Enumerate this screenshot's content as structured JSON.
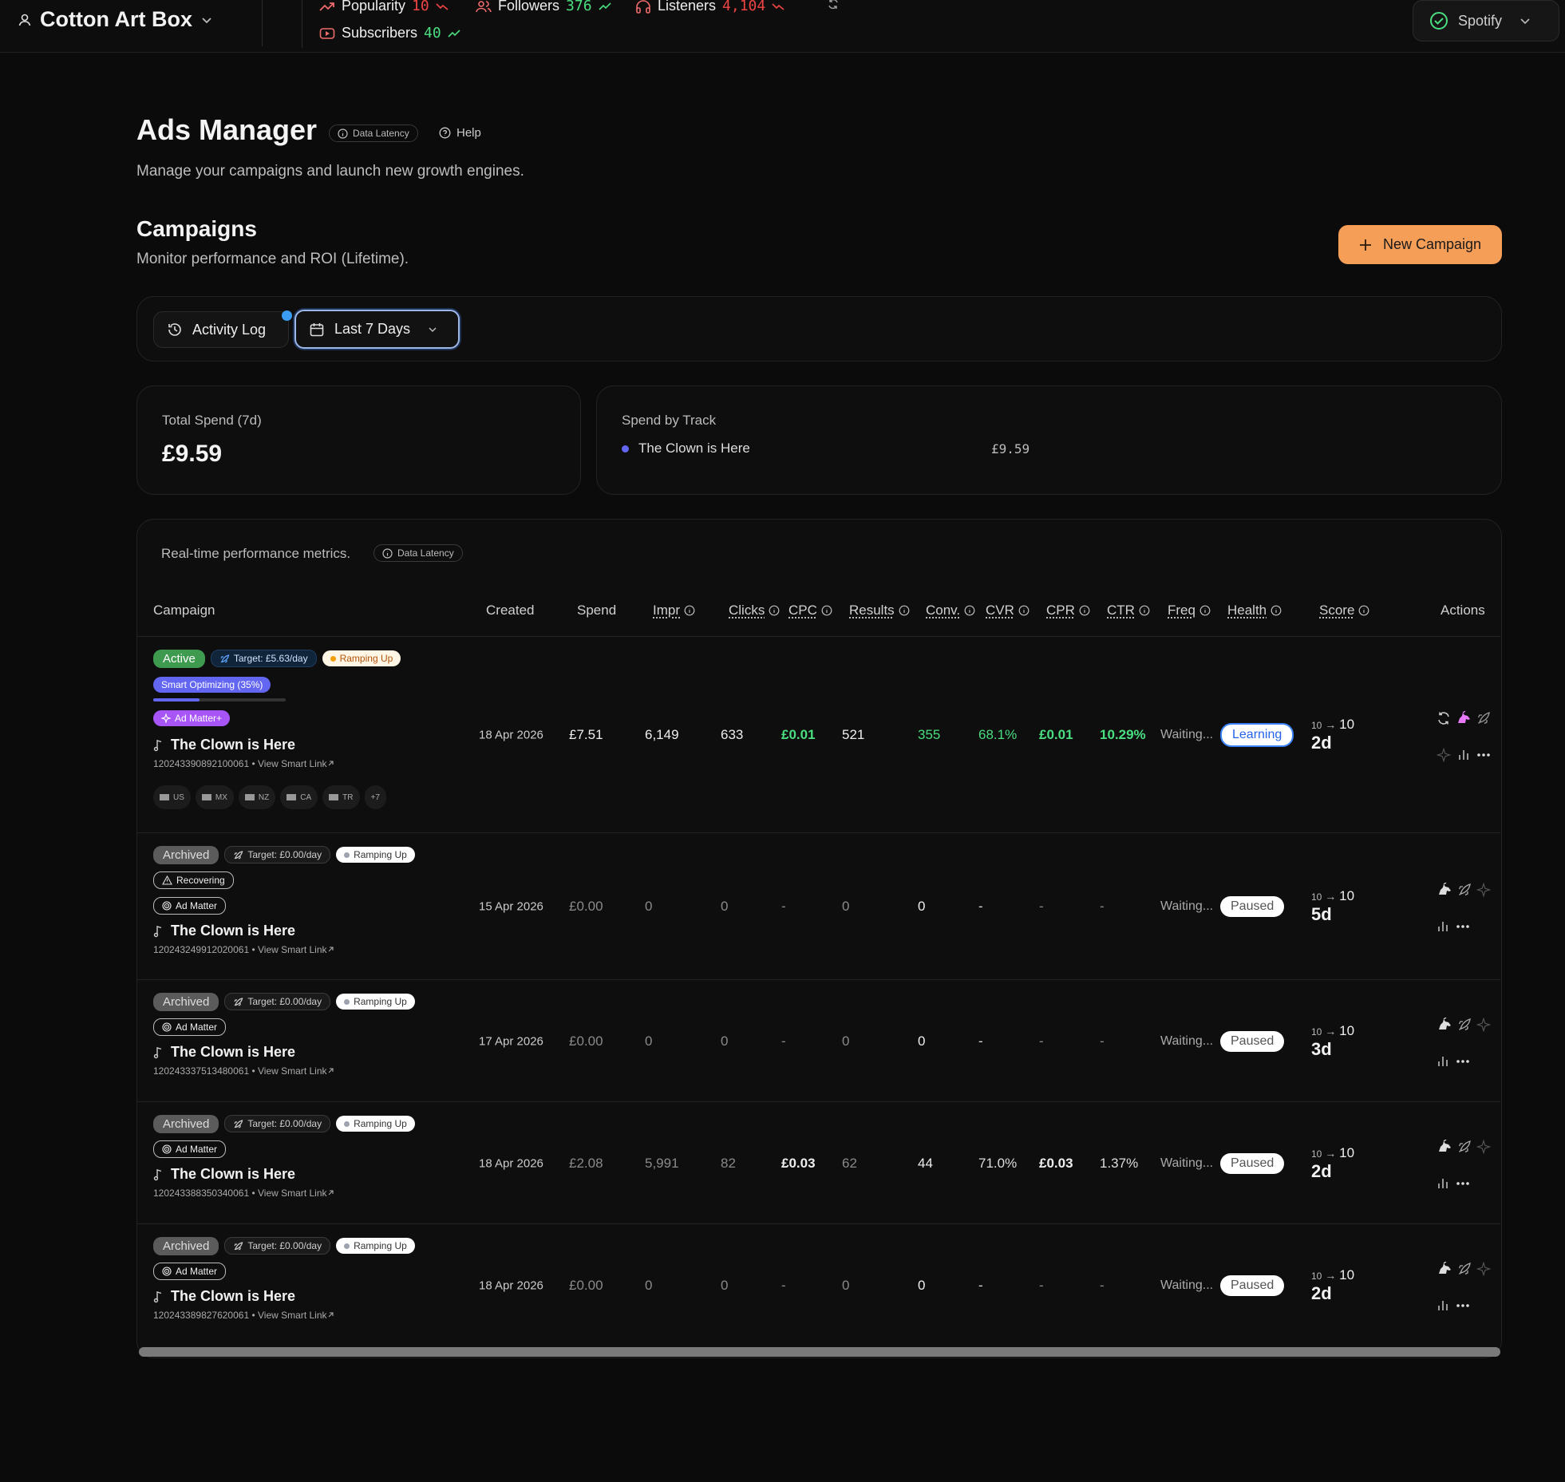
{
  "topbar": {
    "account_name": "Cotton Art Box",
    "stats": [
      {
        "label": "Popularity",
        "value": "10",
        "trend": "down"
      },
      {
        "label": "Followers",
        "value": "376",
        "trend": "up"
      },
      {
        "label": "Listeners",
        "value": "4,104",
        "trend": "down"
      },
      {
        "label": "Subscribers",
        "value": "40",
        "trend": "up"
      }
    ],
    "platform": "Spotify"
  },
  "header": {
    "title": "Ads Manager",
    "data_latency": "Data Latency",
    "help": "Help",
    "subtitle": "Manage your campaigns and launch new growth engines."
  },
  "campaigns_section": {
    "title": "Campaigns",
    "subtitle": "Monitor performance and ROI (Lifetime).",
    "new_button": "New Campaign"
  },
  "controls": {
    "activity_log": "Activity Log",
    "date_range": "Last 7 Days"
  },
  "summary": {
    "total_spend_label": "Total Spend (7d)",
    "total_spend_value": "£9.59",
    "spend_by_track_label": "Spend by Track",
    "tracks": [
      {
        "name": "The Clown is Here",
        "value": "£9.59"
      }
    ]
  },
  "table": {
    "caption": "Real-time performance metrics.",
    "data_latency": "Data Latency",
    "columns": [
      "Campaign",
      "Created",
      "Spend",
      "Impr",
      "Clicks",
      "CPC",
      "Results",
      "Conv.",
      "CVR",
      "CPR",
      "CTR",
      "Freq",
      "Health",
      "Score",
      "Actions"
    ],
    "rows": [
      {
        "status": "Active",
        "target": "Target: £5.63/day",
        "ramp": "Ramping Up",
        "smart": "Smart Optimizing (35%)",
        "smart_progress": 0.35,
        "admatter": "Ad Matter+",
        "track": "The Clown is Here",
        "id": "120243390892100061",
        "link": "View Smart Link",
        "countries": [
          "US",
          "MX",
          "NZ",
          "CA",
          "TR"
        ],
        "more": "+7",
        "created": "18 Apr 2026",
        "spend": "£7.51",
        "impr": "6,149",
        "clicks": "633",
        "cpc": "£0.01",
        "results": "521",
        "conv": "355",
        "cvr": "68.1%",
        "cpr": "£0.01",
        "ctr": "10.29%",
        "freq": "Waiting...",
        "health": "Learning",
        "score_from": "10",
        "score_to": "10",
        "age": "2d"
      },
      {
        "status": "Archived",
        "target": "Target: £0.00/day",
        "ramp": "Ramping Up",
        "recovering": "Recovering",
        "admatter": "Ad Matter",
        "track": "The Clown is Here",
        "id": "120243249912020061",
        "link": "View Smart Link",
        "created": "15 Apr 2026",
        "spend": "£0.00",
        "impr": "0",
        "clicks": "0",
        "cpc": "-",
        "results": "0",
        "conv": "0",
        "cvr": "-",
        "cpr": "-",
        "ctr": "-",
        "freq": "Waiting...",
        "health": "Paused",
        "score_from": "10",
        "score_to": "10",
        "age": "5d"
      },
      {
        "status": "Archived",
        "target": "Target: £0.00/day",
        "ramp": "Ramping Up",
        "admatter": "Ad Matter",
        "track": "The Clown is Here",
        "id": "120243337513480061",
        "link": "View Smart Link",
        "created": "17 Apr 2026",
        "spend": "£0.00",
        "impr": "0",
        "clicks": "0",
        "cpc": "-",
        "results": "0",
        "conv": "0",
        "cvr": "-",
        "cpr": "-",
        "ctr": "-",
        "freq": "Waiting...",
        "health": "Paused",
        "score_from": "10",
        "score_to": "10",
        "age": "3d"
      },
      {
        "status": "Archived",
        "target": "Target: £0.00/day",
        "ramp": "Ramping Up",
        "admatter": "Ad Matter",
        "track": "The Clown is Here",
        "id": "120243388350340061",
        "link": "View Smart Link",
        "created": "18 Apr 2026",
        "spend": "£2.08",
        "impr": "5,991",
        "clicks": "82",
        "cpc": "£0.03",
        "results": "62",
        "conv": "44",
        "cvr": "71.0%",
        "cpr": "£0.03",
        "ctr": "1.37%",
        "freq": "Waiting...",
        "health": "Paused",
        "score_from": "10",
        "score_to": "10",
        "age": "2d"
      },
      {
        "status": "Archived",
        "target": "Target: £0.00/day",
        "ramp": "Ramping Up",
        "admatter": "Ad Matter",
        "track": "The Clown is Here",
        "id": "120243389827620061",
        "link": "View Smart Link",
        "created": "18 Apr 2026",
        "spend": "£0.00",
        "impr": "0",
        "clicks": "0",
        "cpc": "-",
        "results": "0",
        "conv": "0",
        "cvr": "-",
        "cpr": "-",
        "ctr": "-",
        "freq": "Waiting...",
        "health": "Paused",
        "score_from": "10",
        "score_to": "10",
        "age": "2d"
      }
    ]
  },
  "colors": {
    "accent": "#f59e58",
    "positive": "#4ade80",
    "negative": "#ef4444",
    "learning": "#2563eb",
    "smart": "#6366f1",
    "admatter_plus": "#a855f7",
    "active": "#3e9a4f"
  }
}
